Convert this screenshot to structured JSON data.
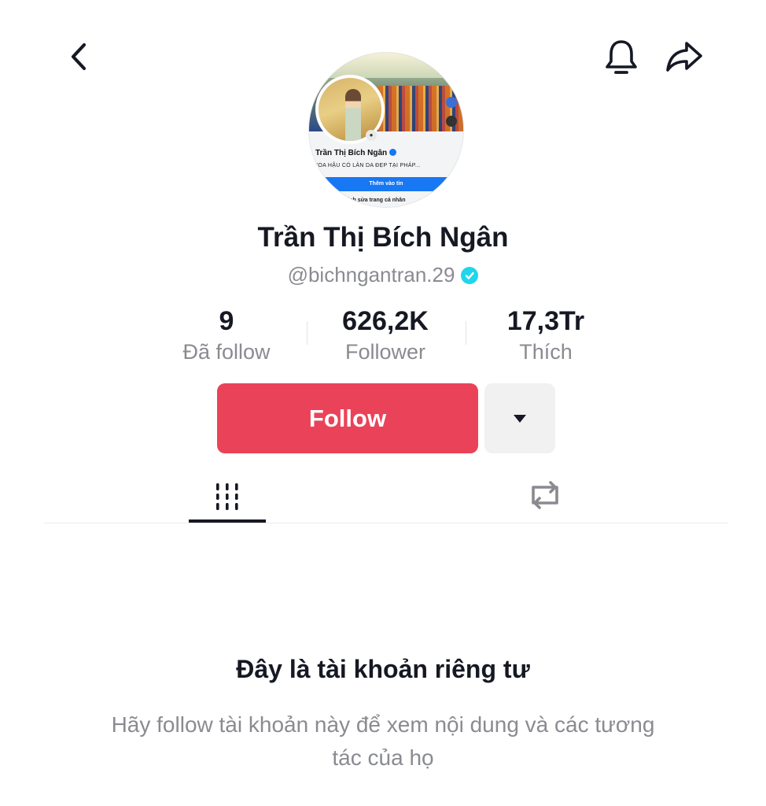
{
  "header": {
    "back_icon": "chevron-left-icon",
    "bell_icon": "bell-icon",
    "share_icon": "share-icon"
  },
  "avatar_image": {
    "name": "Trần Thị Bích Ngân",
    "bio": "HOA HẬU CÓ LÀN DA ĐẸP TẠI PHÁP...",
    "button": "Thêm vào tin",
    "edit": "Chỉnh sửa trang cá nhân"
  },
  "profile": {
    "display_name": "Trần Thị Bích Ngân",
    "handle": "@bichngantran.29",
    "verified_color": "#20d5ec"
  },
  "stats": [
    {
      "value": "9",
      "label": "Đã follow"
    },
    {
      "value": "626,2K",
      "label": "Follower"
    },
    {
      "value": "17,3Tr",
      "label": "Thích"
    }
  ],
  "actions": {
    "follow_label": "Follow",
    "follow_color": "#ea4359",
    "more_icon": "caret-down-icon"
  },
  "tabs": {
    "videos_icon": "grid-icon",
    "reposts_icon": "repost-icon"
  },
  "private": {
    "title": "Đây là tài khoản riêng tư",
    "description": "Hãy follow tài khoản này để xem nội dung và các tương tác của họ"
  }
}
